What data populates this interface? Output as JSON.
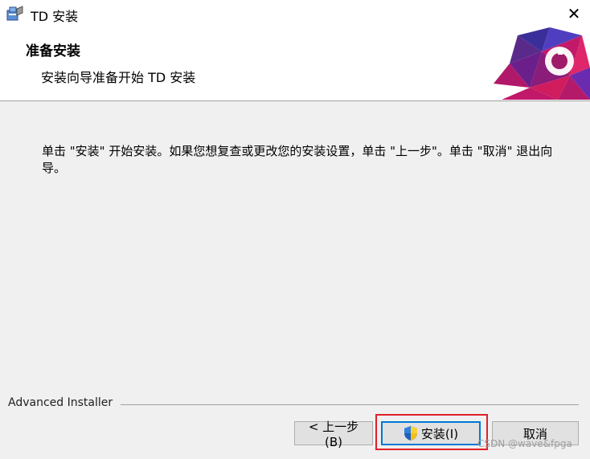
{
  "window": {
    "title": "TD 安装",
    "close_glyph": "✕"
  },
  "header": {
    "title": "准备安装",
    "subtitle": "安装向导准备开始 TD 安装",
    "logo_icon": "installer-logo-icon"
  },
  "body": {
    "message": "单击 \"安装\" 开始安装。如果您想复查或更改您的安装设置，单击 \"上一步\"。单击 \"取消\" 退出向导。"
  },
  "footer": {
    "brand": "Advanced Installer",
    "buttons": {
      "back": "< 上一步(B)",
      "install": "安装(I)",
      "cancel": "取消"
    },
    "install_icon": "uac-shield-icon"
  },
  "watermark": "CSDN @wave&fpga",
  "colors": {
    "highlight_border": "#e0202a",
    "default_button_border": "#0078d7",
    "background": "#f0f0f0"
  }
}
